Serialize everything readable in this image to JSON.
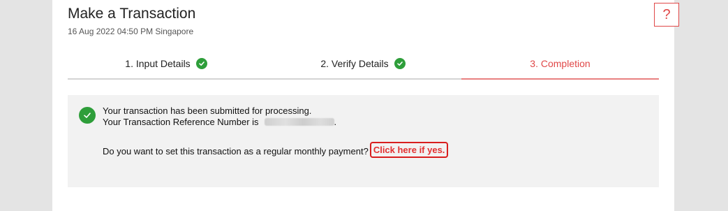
{
  "header": {
    "title": "Make a Transaction",
    "datetime": "16 Aug 2022 04:50 PM Singapore",
    "help_label": "?"
  },
  "steps": [
    {
      "label": "1. Input Details",
      "status": "complete"
    },
    {
      "label": "2. Verify Details",
      "status": "complete"
    },
    {
      "label": "3. Completion",
      "status": "active"
    }
  ],
  "completion": {
    "message_line1": "Your transaction has been submitted for processing.",
    "message_line2_prefix": "Your Transaction Reference Number is",
    "message_line2_suffix": ".",
    "reference_number_obscured": true,
    "question": "Do you want to set this transaction as a regular monthly payment?",
    "link_label": "Click here if yes."
  },
  "colors": {
    "accent": "#e04848",
    "success": "#2e9e3a",
    "link_highlight": "#d81e1e"
  }
}
